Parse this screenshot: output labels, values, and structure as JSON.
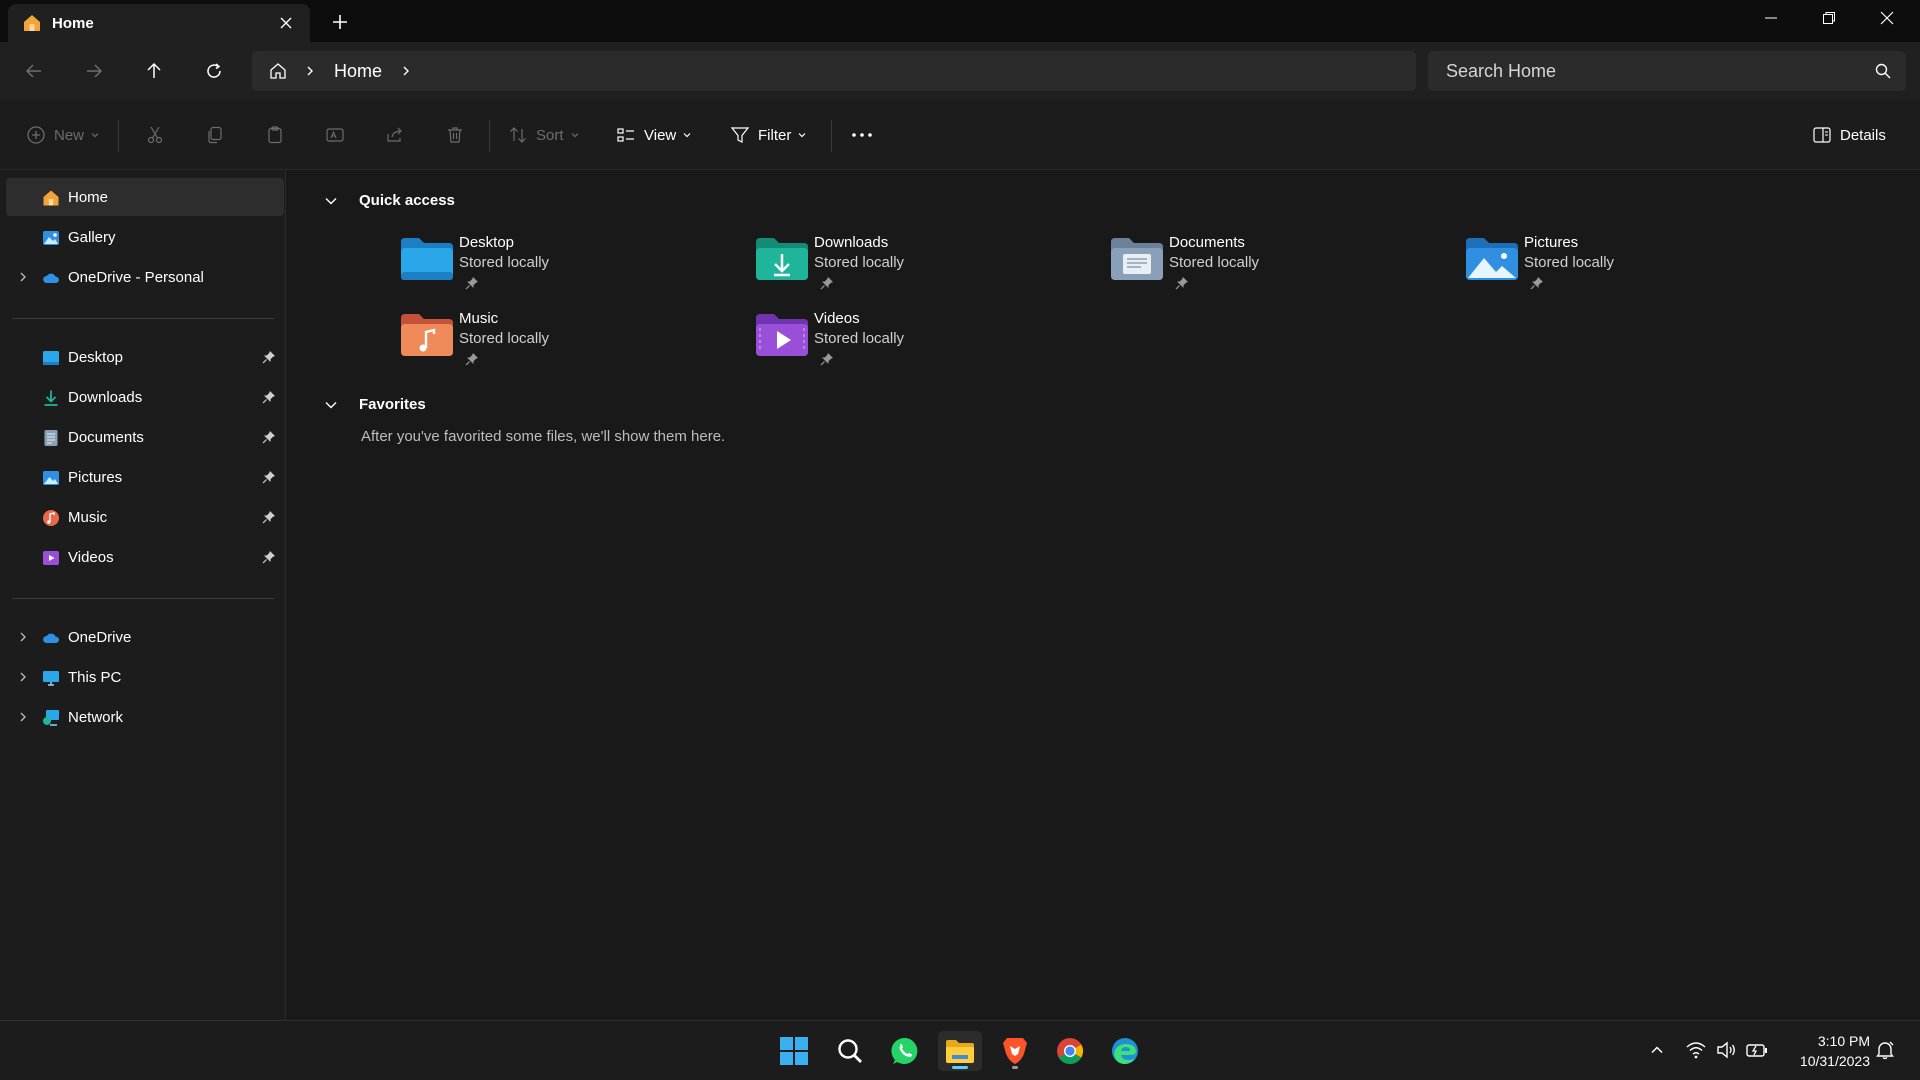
{
  "window": {
    "tab_title": "Home",
    "controls": [
      "minimize",
      "restore",
      "close"
    ]
  },
  "address": {
    "crumb": "Home",
    "search_placeholder": "Search Home"
  },
  "commands": {
    "new_label": "New",
    "sort_label": "Sort",
    "view_label": "View",
    "filter_label": "Filter",
    "details_label": "Details"
  },
  "sidebar": {
    "top": [
      {
        "label": "Home",
        "icon": "home-icon",
        "active": true
      },
      {
        "label": "Gallery",
        "icon": "gallery-icon"
      },
      {
        "label": "OneDrive - Personal",
        "icon": "onedrive-icon",
        "expandable": true
      }
    ],
    "pinned": [
      {
        "label": "Desktop",
        "icon": "desktop-folder-icon"
      },
      {
        "label": "Downloads",
        "icon": "downloads-icon"
      },
      {
        "label": "Documents",
        "icon": "documents-icon"
      },
      {
        "label": "Pictures",
        "icon": "pictures-icon"
      },
      {
        "label": "Music",
        "icon": "music-icon"
      },
      {
        "label": "Videos",
        "icon": "videos-icon"
      }
    ],
    "locations": [
      {
        "label": "OneDrive",
        "icon": "onedrive-icon"
      },
      {
        "label": "This PC",
        "icon": "this-pc-icon"
      },
      {
        "label": "Network",
        "icon": "network-icon"
      }
    ]
  },
  "main": {
    "quick_access_title": "Quick access",
    "quick_access": [
      {
        "name": "Desktop",
        "status": "Stored locally",
        "color": "#2aa7e8"
      },
      {
        "name": "Downloads",
        "status": "Stored locally",
        "color": "#1fb59a"
      },
      {
        "name": "Documents",
        "status": "Stored locally",
        "color": "#8aa0b8"
      },
      {
        "name": "Pictures",
        "status": "Stored locally",
        "color": "#2f8fe0"
      },
      {
        "name": "Music",
        "status": "Stored locally",
        "color": "#e86a4a"
      },
      {
        "name": "Videos",
        "status": "Stored locally",
        "color": "#9a4fd8"
      }
    ],
    "favorites_title": "Favorites",
    "favorites_empty": "After you've favorited some files, we'll show them here."
  },
  "taskbar": {
    "apps": [
      "start-icon",
      "search-icon",
      "whatsapp-icon",
      "file-explorer-icon",
      "brave-icon",
      "chrome-icon",
      "edge-icon"
    ],
    "time": "3:10 PM",
    "date": "10/31/2023"
  },
  "colors": {
    "accent": "#60cdff",
    "background": "#191919"
  }
}
